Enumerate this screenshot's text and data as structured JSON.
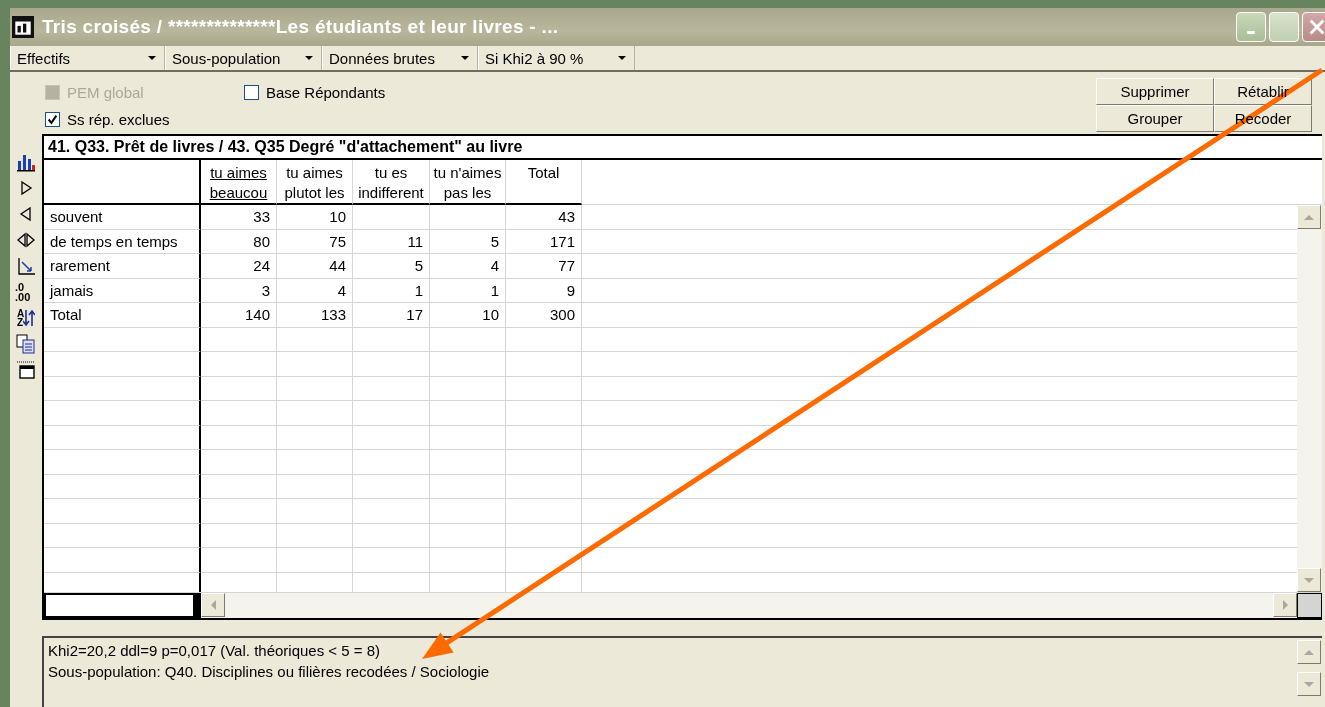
{
  "window": {
    "title": "Tris croisés / **************Les étudiants et leur livres - ..."
  },
  "dropdowns": [
    {
      "label": "Effectifs"
    },
    {
      "label": "Sous-population"
    },
    {
      "label": "Données brutes"
    },
    {
      "label": "Si Khi2 à 90 %"
    }
  ],
  "options": [
    {
      "label": "PEM global",
      "checked": false,
      "disabled": true
    },
    {
      "label": "Base Répondants",
      "checked": false,
      "disabled": false
    },
    {
      "label": "Ss rép. exclues",
      "checked": true,
      "disabled": false
    }
  ],
  "buttons": [
    "Supprimer",
    "Rétablir",
    "Grouper",
    "Recoder"
  ],
  "toolbar": [
    {
      "kind": "bar-chart"
    },
    {
      "kind": "next"
    },
    {
      "kind": "previous"
    },
    {
      "kind": "both"
    },
    {
      "kind": "axis"
    },
    {
      "kind": "decimals",
      "glyph_top": ".0",
      "glyph_bottom": ".00"
    },
    {
      "kind": "sort",
      "glyph": "AZ"
    },
    {
      "kind": "copy"
    },
    {
      "kind": "window"
    }
  ],
  "table": {
    "title": "41. Q33. Prêt de livres / 43. Q35 Degré \"d'attachement\" au livre",
    "columns": [
      {
        "line_1": "tu aimes",
        "line_2": "beaucou",
        "selected": true
      },
      {
        "line_1": "tu aimes",
        "line_2": "plutot les",
        "selected": false
      },
      {
        "line_1": "tu es",
        "line_2": "indifferent",
        "selected": false
      },
      {
        "line_1": "tu n'aimes",
        "line_2": "pas les",
        "selected": false
      },
      {
        "line_1": "Total",
        "selected": false
      }
    ],
    "rows": [
      {
        "label": "souvent",
        "cells": [
          "33",
          "10",
          "",
          "",
          "43"
        ]
      },
      {
        "label": "de temps en temps",
        "cells": [
          "80",
          "75",
          "11",
          "5",
          "171"
        ]
      },
      {
        "label": "rarement",
        "cells": [
          "24",
          "44",
          "5",
          "4",
          "77"
        ]
      },
      {
        "label": "jamais",
        "cells": [
          "3",
          "4",
          "1",
          "1",
          "9"
        ]
      },
      {
        "label": "Total",
        "cells": [
          "140",
          "133",
          "17",
          "10",
          "300"
        ]
      }
    ]
  },
  "status": [
    "Khi2=20,2  ddl=9  p=0,017  (Val. théoriques < 5 = 8)",
    "Sous-population: Q40. Disciplines ou filières recodées / Sociologie"
  ]
}
